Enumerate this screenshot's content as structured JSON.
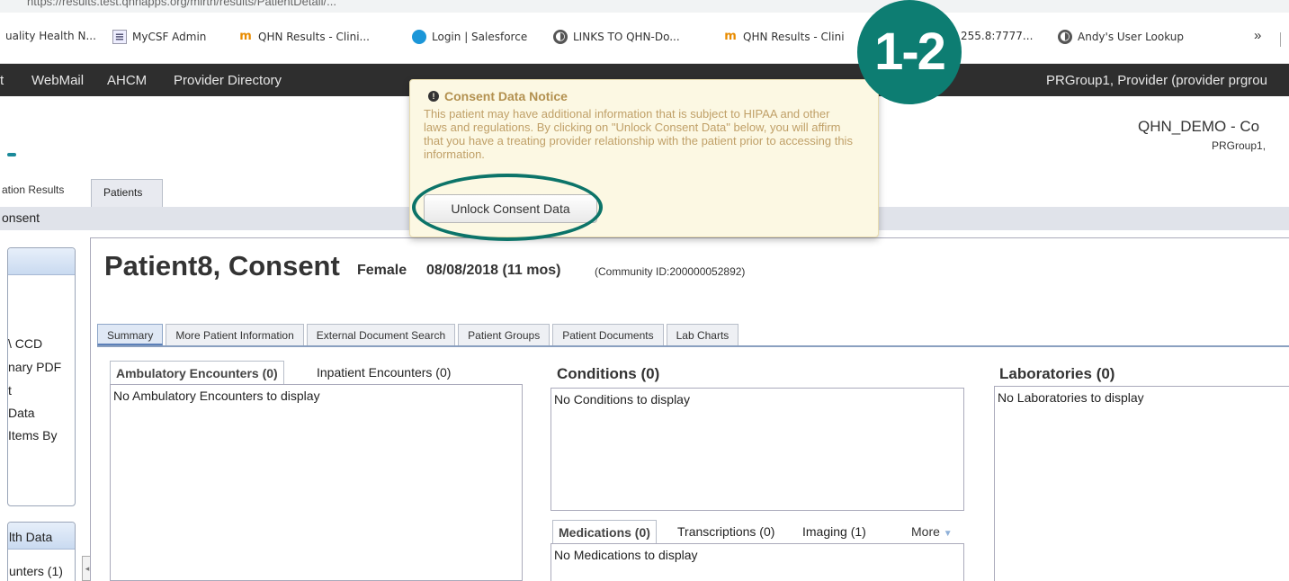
{
  "browser": {
    "url": "https://results.test.qhnapps.org/mirth/results/PatientDetail/...",
    "bookmarks": [
      {
        "label": "uality Health N...",
        "icon": "page-icon"
      },
      {
        "label": "MyCSF Admin",
        "icon": "page-icon"
      },
      {
        "label": "QHN Results - Clini...",
        "icon": "m-icon"
      },
      {
        "label": "Login | Salesforce",
        "icon": "salesforce-cloud-icon"
      },
      {
        "label": "LINKS TO QHN-Do...",
        "icon": "globe-icon"
      },
      {
        "label": "QHN Results - Clini",
        "icon": "m-icon"
      },
      {
        "label": "255.8:7777...",
        "icon": "globe-icon"
      },
      {
        "label": "Andy's User Lookup",
        "icon": "globe-icon"
      }
    ],
    "more_label": "»"
  },
  "nav": {
    "items": [
      "t",
      "WebMail",
      "AHCM",
      "Provider Directory"
    ],
    "user": "PRGroup1, Provider (provider prgrou"
  },
  "header": {
    "org": "QHN_DEMO - Co",
    "org_user": "PRGroup1,"
  },
  "top_tabs": {
    "prev": "ation Results",
    "active": "Patients"
  },
  "subbar": "onsent",
  "left_panel": {
    "items": [
      "\\ CCD",
      "nary PDF",
      "t",
      "Data",
      "Items By"
    ],
    "panel2_header": "lth Data",
    "panel2_item": "unters (1)"
  },
  "patient": {
    "name": "Patient8, Consent",
    "gender": "Female",
    "dob": "08/08/2018 (11 mos)",
    "community_id": "(Community ID:200000052892)"
  },
  "patient_tabs": [
    "Summary",
    "More Patient Information",
    "External Document Search",
    "Patient Groups",
    "Patient Documents",
    "Lab Charts"
  ],
  "encounters": {
    "tab_active": "Ambulatory Encounters (0)",
    "tab_other": "Inpatient Encounters (0)",
    "empty": "No Ambulatory Encounters to display"
  },
  "conditions": {
    "title": "Conditions (0)",
    "empty": "No Conditions to display"
  },
  "laboratories": {
    "title": "Laboratories (0)",
    "empty": "No Laboratories to display"
  },
  "medications": {
    "tab_active": "Medications (0)",
    "tab_transcriptions": "Transcriptions (0)",
    "tab_imaging": "Imaging (1)",
    "more": "More",
    "empty": "No Medications to display"
  },
  "consent_notice": {
    "title": "Consent Data Notice",
    "body": "This patient may have additional information that is subject to HIPAA and other laws and regulations. By clicking on \"Unlock Consent Data\" below, you will affirm that you have a treating provider relationship with the patient prior to accessing this information.",
    "button": "Unlock Consent Data"
  },
  "step_badge": "1-2",
  "colors": {
    "badge": "#0d7d72",
    "ring": "#0c7469",
    "navbar": "#2e2e2e",
    "notice_bg": "#fcf8e3",
    "notice_text": "#c0a068"
  }
}
